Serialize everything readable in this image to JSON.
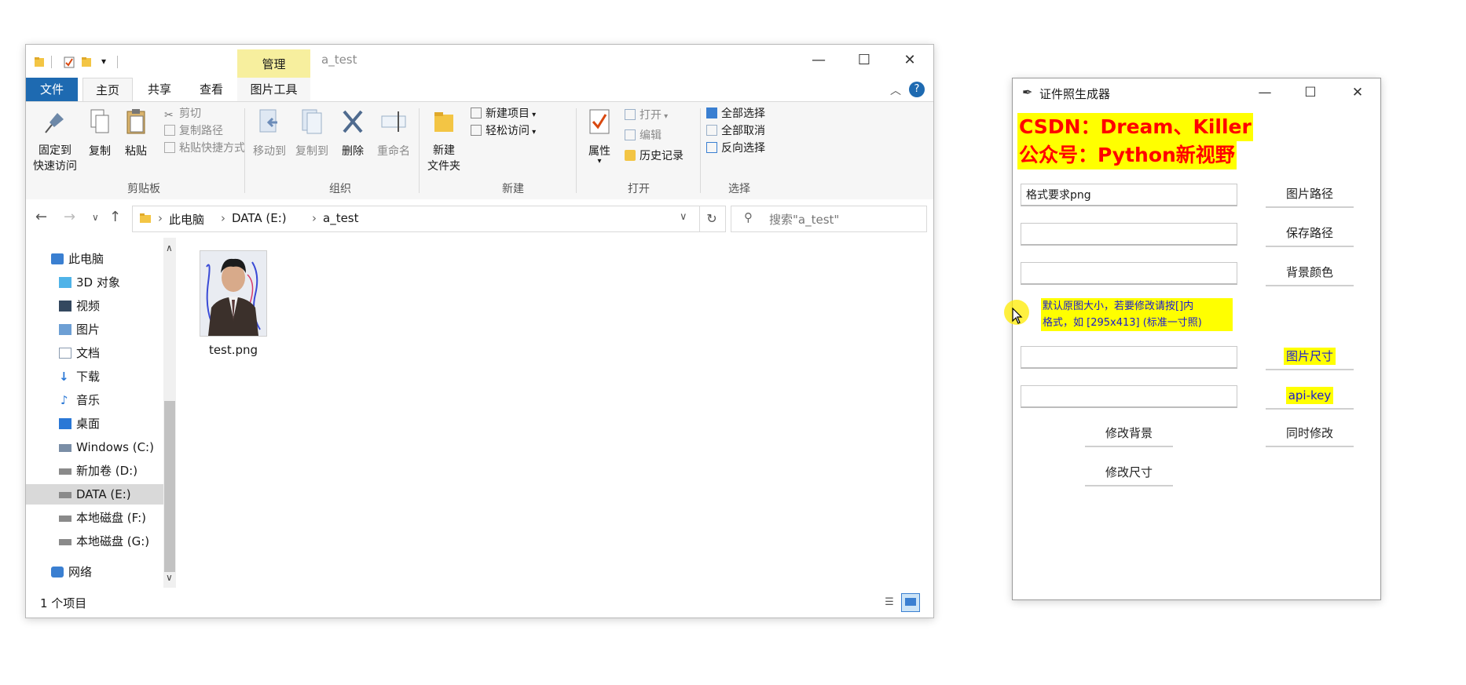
{
  "explorer": {
    "window_title": "a_test",
    "context_tab_header": "管理",
    "tabs": [
      {
        "label": "文件"
      },
      {
        "label": "主页"
      },
      {
        "label": "共享"
      },
      {
        "label": "查看"
      },
      {
        "label": "图片工具"
      }
    ],
    "ribbon": {
      "pin": "固定到\n快速访问",
      "copy": "复制",
      "paste": "粘贴",
      "cut": "剪切",
      "copy_path": "复制路径",
      "paste_shortcut": "粘贴快捷方式",
      "move_to": "移动到",
      "copy_to": "复制到",
      "delete": "删除",
      "rename": "重命名",
      "new_folder": "新建\n文件夹",
      "new_item": "新建项目",
      "easy_access": "轻松访问",
      "properties": "属性",
      "open": "打开",
      "edit": "编辑",
      "history": "历史记录",
      "select_all": "全部选择",
      "select_none": "全部取消",
      "invert_select": "反向选择",
      "groups": {
        "clipboard": "剪贴板",
        "organize": "组织",
        "new": "新建",
        "open": "打开",
        "select": "选择"
      }
    },
    "address": {
      "crumbs": [
        "此电脑",
        "DATA (E:)",
        "a_test"
      ],
      "search_placeholder": "搜索\"a_test\""
    },
    "nav": [
      {
        "label": "此电脑",
        "icon": "pc-icon"
      },
      {
        "label": "3D 对象",
        "icon": "cube-icon"
      },
      {
        "label": "视频",
        "icon": "video-icon"
      },
      {
        "label": "图片",
        "icon": "picture-icon"
      },
      {
        "label": "文档",
        "icon": "document-icon"
      },
      {
        "label": "下载",
        "icon": "download-icon"
      },
      {
        "label": "音乐",
        "icon": "music-icon"
      },
      {
        "label": "桌面",
        "icon": "desktop-icon"
      },
      {
        "label": "Windows (C:)",
        "icon": "drive-icon"
      },
      {
        "label": "新加卷 (D:)",
        "icon": "drive-icon"
      },
      {
        "label": "DATA (E:)",
        "icon": "drive-icon"
      },
      {
        "label": "本地磁盘 (F:)",
        "icon": "drive-icon"
      },
      {
        "label": "本地磁盘 (G:)",
        "icon": "drive-icon"
      },
      {
        "label": "网络",
        "icon": "network-icon"
      }
    ],
    "files": [
      {
        "name": "test.png"
      }
    ],
    "status": "1 个项目",
    "colors": {
      "file_tab": "#1e6ab1",
      "context_tab": "#f7ef9e",
      "selected_nav": "#d9d9d9"
    }
  },
  "generator": {
    "title": "证件照生成器",
    "banner_line1": "CSDN：Dream、Killer",
    "banner_line2": "公众号：Python新视野",
    "entry1_value": "格式要求png",
    "note_line1": "默认原图大小，若要修改请按[]内",
    "note_line2": "格式，如 [295x413] (标准一寸照)",
    "btn_image_path": "图片路径",
    "btn_save_path": "保存路径",
    "btn_bg_color": "背景颜色",
    "btn_image_size": "图片尺寸",
    "btn_api_key": "api-key",
    "btn_change_bg": "修改背景",
    "btn_change_both": "同时修改",
    "btn_change_size": "修改尺寸",
    "colors": {
      "banner_bg": "#ffff00",
      "banner_text": "#ff0000",
      "note_text": "#1a1ad0"
    }
  }
}
